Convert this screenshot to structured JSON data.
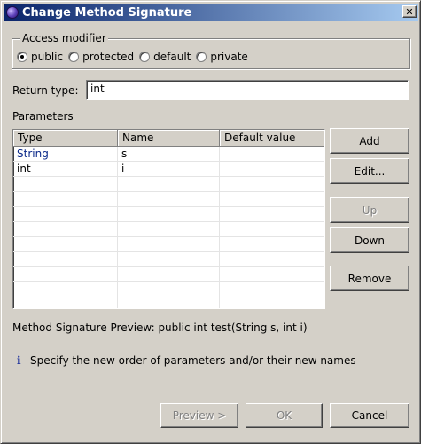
{
  "window": {
    "title": "Change Method Signature",
    "close_glyph": "✕"
  },
  "access_modifier": {
    "legend": "Access modifier",
    "options": [
      {
        "label": "public",
        "checked": true
      },
      {
        "label": "protected",
        "checked": false
      },
      {
        "label": "default",
        "checked": false
      },
      {
        "label": "private",
        "checked": false
      }
    ]
  },
  "return_type": {
    "label": "Return type:",
    "value": "int"
  },
  "parameters": {
    "label": "Parameters",
    "columns": [
      "Type",
      "Name",
      "Default value"
    ],
    "rows": [
      {
        "type": "String",
        "name": "s",
        "default": ""
      },
      {
        "type": "int",
        "name": "i",
        "default": ""
      }
    ]
  },
  "side_buttons": {
    "add": "Add",
    "edit": "Edit...",
    "up": "Up",
    "down": "Down",
    "remove": "Remove"
  },
  "preview": {
    "text": "Method Signature Preview: public int test(String s, int i)"
  },
  "info": {
    "icon": "i",
    "text": "Specify the new order of parameters and/or their new names"
  },
  "footer_buttons": {
    "preview": "Preview >",
    "ok": "OK",
    "cancel": "Cancel"
  }
}
